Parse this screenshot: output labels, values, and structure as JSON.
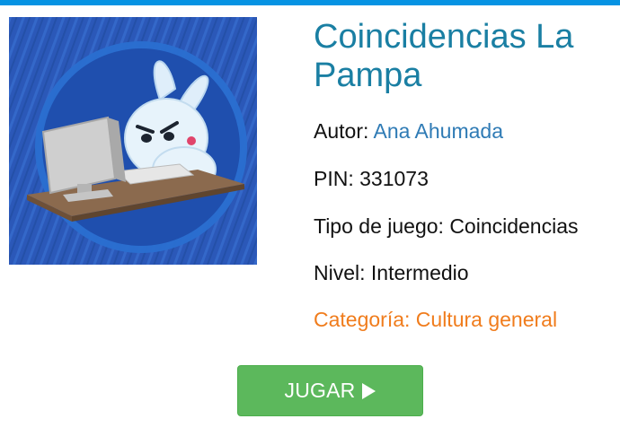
{
  "colors": {
    "top_bar": "#0693e3",
    "title": "#1a7fa3",
    "author_link": "#2f7bb5",
    "category": "#f07c1c",
    "play_button": "#5cb85c"
  },
  "game": {
    "title": "Coincidencias La Pampa",
    "author_label": "Autor:",
    "author_name": "Ana Ahumada",
    "pin_label": "PIN:",
    "pin_value": "331073",
    "type_label": "Tipo de juego:",
    "type_value": "Coincidencias",
    "level_label": "Nivel:",
    "level_value": "Intermedio",
    "category_label": "Categoría:",
    "category_value": "Cultura general"
  },
  "play_button": {
    "label": "JUGAR",
    "icon": "play-icon"
  },
  "thumbnail": {
    "icon": "bunny-at-computer-illustration"
  }
}
